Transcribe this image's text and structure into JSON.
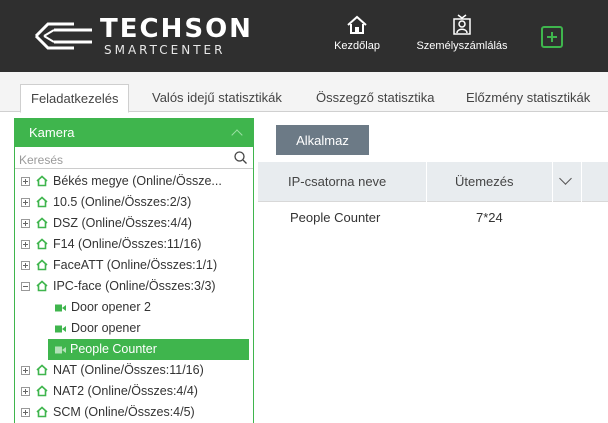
{
  "header": {
    "logo_title": "TECHSON",
    "logo_subtitle": "SMARTCENTER",
    "nav": [
      {
        "label": "Kezdőlap",
        "icon": "home-icon"
      },
      {
        "label": "Személyszámlálás",
        "icon": "people-count-icon"
      }
    ],
    "add_icon": "plus-icon"
  },
  "tabs": [
    {
      "label": "Feladatkezelés",
      "active": true
    },
    {
      "label": "Valós idejű statisztikák",
      "active": false
    },
    {
      "label": "Összegző statisztika",
      "active": false
    },
    {
      "label": "Előzmény statisztikák",
      "active": false
    }
  ],
  "camera_panel": {
    "title": "Kamera",
    "search_placeholder": "Keresés",
    "tree": [
      {
        "label": "Békés megye (Online/Össze...",
        "expanded": false
      },
      {
        "label": "10.5 (Online/Összes:2/3)",
        "expanded": false
      },
      {
        "label": "DSZ (Online/Összes:4/4)",
        "expanded": false
      },
      {
        "label": "F14 (Online/Összes:11/16)",
        "expanded": false
      },
      {
        "label": "FaceATT (Online/Összes:1/1)",
        "expanded": false
      },
      {
        "label": "IPC-face (Online/Összes:3/3)",
        "expanded": true
      },
      {
        "label": "NAT (Online/Összes:11/16)",
        "expanded": false
      },
      {
        "label": "NAT2 (Online/Összes:4/4)",
        "expanded": false
      },
      {
        "label": "SCM (Online/Összes:4/5)",
        "expanded": false
      }
    ],
    "children": [
      {
        "label": "Door opener 2",
        "selected": false
      },
      {
        "label": "Door opener",
        "selected": false
      },
      {
        "label": "People Counter",
        "selected": true
      }
    ]
  },
  "main": {
    "apply_label": "Alkalmaz",
    "columns": [
      "IP-csatorna neve",
      "Ütemezés"
    ],
    "rows": [
      {
        "name": "People Counter",
        "schedule": "7*24"
      }
    ]
  },
  "colors": {
    "accent": "#3fb54d",
    "header_bg": "#2f2f2f",
    "apply_button": "#6c7a86"
  }
}
